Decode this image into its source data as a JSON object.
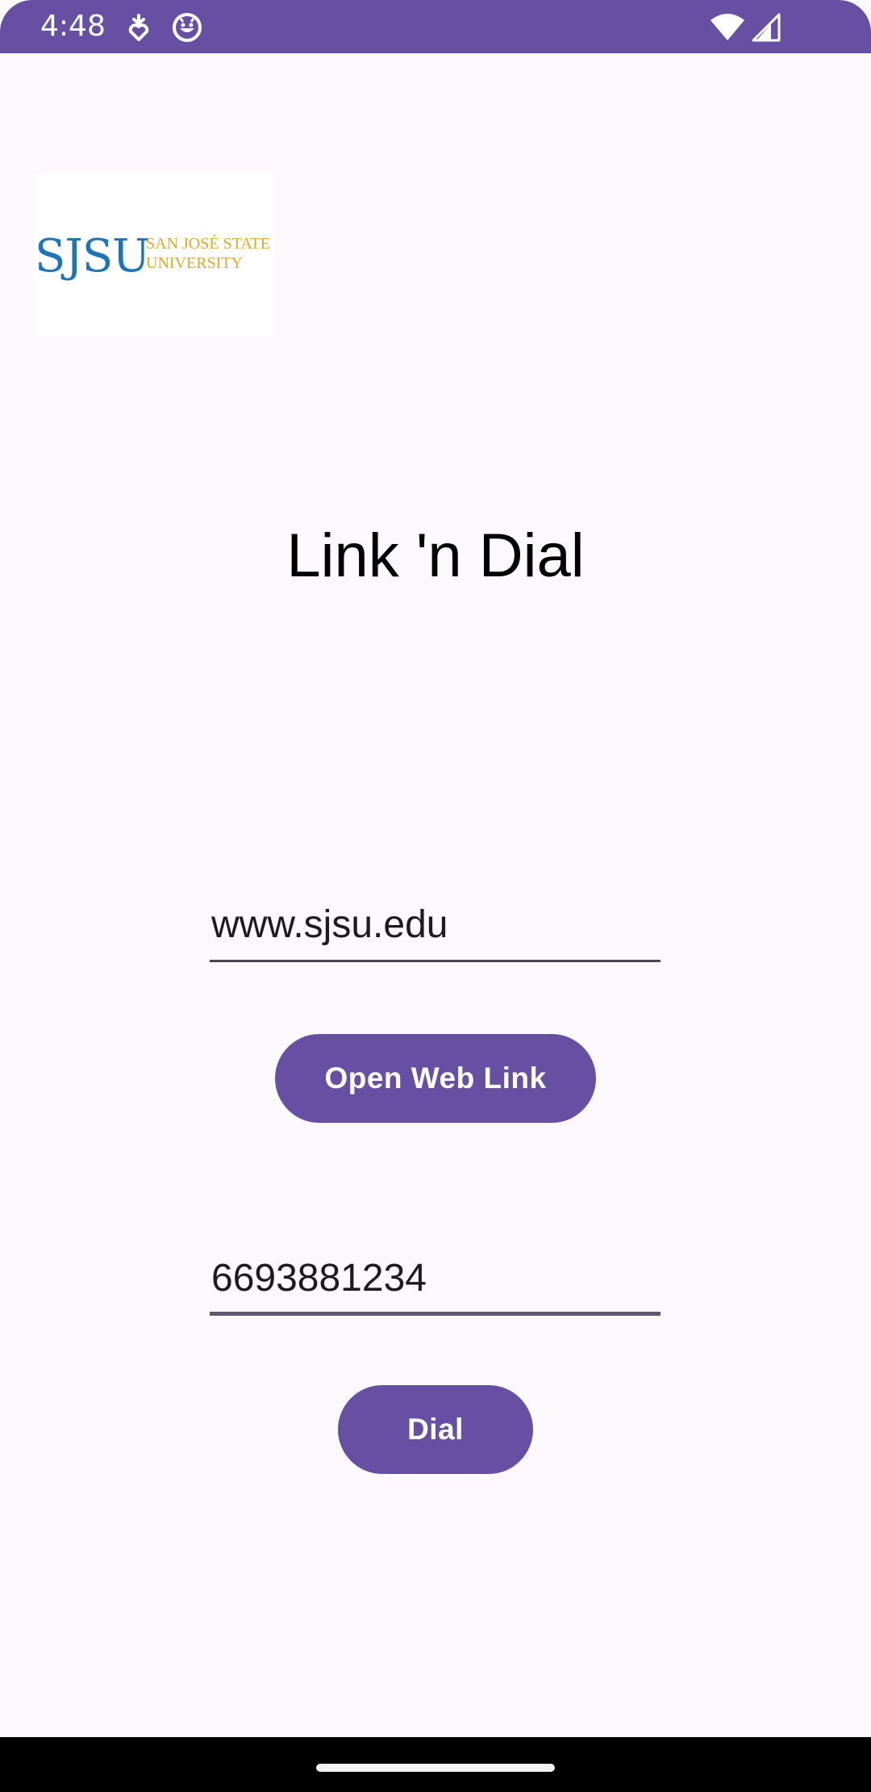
{
  "status_bar": {
    "time": "4:48",
    "icons": [
      "download-status-icon",
      "app-notification-icon",
      "wifi-icon",
      "cellular-signal-icon"
    ],
    "color": "#6750a4"
  },
  "logo": {
    "mark": "SJSU",
    "line1": "SAN JOSÉ STATE",
    "line2": "UNIVERSITY"
  },
  "title": "Link 'n Dial",
  "url_field": {
    "value": "www.sjsu.edu"
  },
  "web_button": {
    "label": "Open Web Link"
  },
  "phone_field": {
    "value": "6693881234"
  },
  "dial_button": {
    "label": "Dial"
  },
  "colors": {
    "accent": "#6750a4",
    "background": "#fdf8fc",
    "sjsu_blue": "#1b75bc",
    "sjsu_gold": "#e5a823"
  }
}
